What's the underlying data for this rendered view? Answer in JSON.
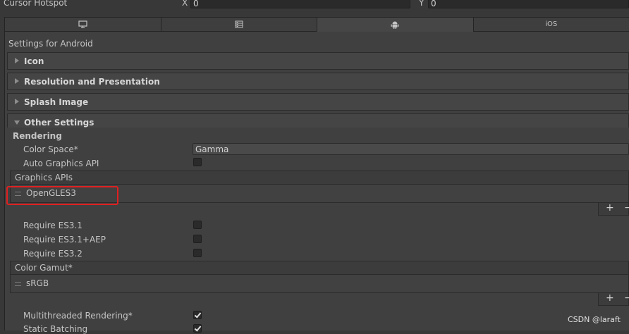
{
  "cursor_hotspot": {
    "label": "Cursor Hotspot",
    "x_label": "X",
    "x_value": "0",
    "y_label": "Y",
    "y_value": "0"
  },
  "tabs": [
    {
      "icon": "monitor-icon",
      "label": ""
    },
    {
      "icon": "server-icon",
      "label": ""
    },
    {
      "icon": "android-icon",
      "label": ""
    },
    {
      "icon": "",
      "label": "iOS"
    }
  ],
  "settings_title": "Settings for Android",
  "sections": {
    "icon": "Icon",
    "resolution": "Resolution and Presentation",
    "splash": "Splash Image",
    "other": "Other Settings"
  },
  "rendering": {
    "header": "Rendering",
    "color_space_label": "Color Space*",
    "color_space_value": "Gamma",
    "auto_graphics_label": "Auto Graphics API",
    "auto_graphics_checked": false,
    "graphics_apis_label": "Graphics APIs",
    "graphics_apis": [
      "OpenGLES3"
    ],
    "require_es31_label": "Require ES3.1",
    "require_es31_aep_label": "Require ES3.1+AEP",
    "require_es32_label": "Require ES3.2",
    "color_gamut_label": "Color Gamut*",
    "color_gamut": [
      "sRGB"
    ],
    "multithreaded_label": "Multithreaded Rendering*",
    "multithreaded_checked": true,
    "static_batching_label": "Static Batching",
    "static_batching_checked": true
  },
  "list_buttons": {
    "add": "+",
    "remove": "−"
  },
  "watermark": "CSDN @laraft",
  "colors": {
    "highlight": "#e02020",
    "background": "#383838"
  }
}
